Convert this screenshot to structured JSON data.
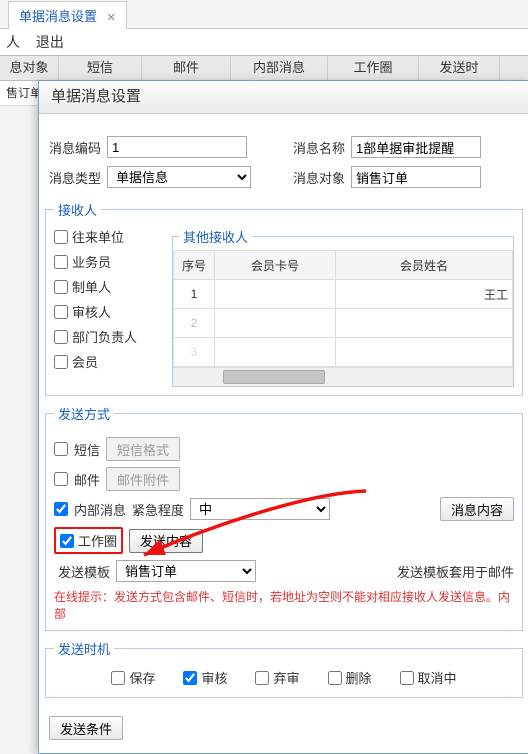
{
  "background": {
    "tab_title": "单据消息设置",
    "menu_left": "人",
    "menu_exit": "退出",
    "cols": [
      "息对象",
      "短信",
      "邮件",
      "内部消息",
      "工作圈",
      "发送时"
    ],
    "row_stub": "售订单"
  },
  "dialog": {
    "title": "单据消息设置",
    "msgCodeLabel": "消息编码",
    "msgCodeValue": "1",
    "msgNameLabel": "消息名称",
    "msgNameValue": "1部单据审批提醒",
    "msgTypeLabel": "消息类型",
    "msgTypeValue": "单据信息",
    "msgObjLabel": "消息对象",
    "msgObjValue": "销售订单"
  },
  "recipients": {
    "legend": "接收人",
    "items": [
      "往来单位",
      "业务员",
      "制单人",
      "审核人",
      "部门负责人",
      "会员"
    ],
    "otherLegend": "其他接收人",
    "cols": [
      "序号",
      "会员卡号",
      "会员姓名"
    ],
    "rows": [
      {
        "no": "1",
        "card": "",
        "name": "王工"
      },
      {
        "no": "2",
        "card": "",
        "name": ""
      },
      {
        "no": "3",
        "card": "",
        "name": ""
      }
    ]
  },
  "send": {
    "legend": "发送方式",
    "smsLabel": "短信",
    "smsBtn": "短信格式",
    "mailLabel": "邮件",
    "mailBtn": "邮件附件",
    "innerLabel": "内部消息",
    "urgLabel": "紧急程度",
    "urgValue": "中",
    "contentBtn": "消息内容",
    "circleLabel": "工作圈",
    "circleBtn": "发送内容",
    "tplLabel": "发送模板",
    "tplValue": "销售订单",
    "tplNote": "发送模板套用于邮件",
    "tip": "在线提示：发送方式包含邮件、短信时，若地址为空则不能对相应接收人发送信息。内部"
  },
  "timing": {
    "legend": "发送时机",
    "items": [
      "保存",
      "审核",
      "弃审",
      "删除",
      "取消中"
    ]
  },
  "condBtn": "发送条件"
}
